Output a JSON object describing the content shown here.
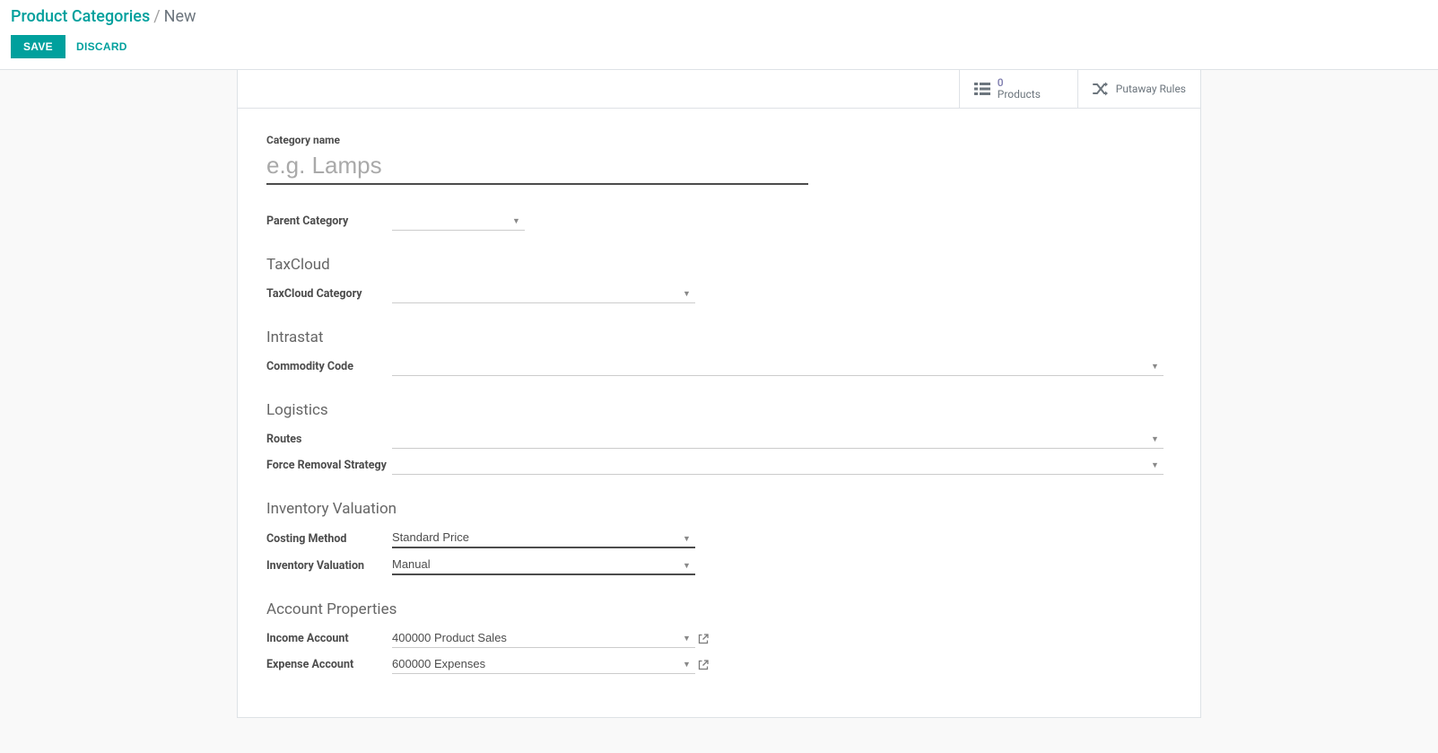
{
  "breadcrumb": {
    "parent": "Product Categories",
    "current": "New"
  },
  "buttons": {
    "save": "SAVE",
    "discard": "DISCARD"
  },
  "statButtons": {
    "products": {
      "count": "0",
      "label": "Products"
    },
    "putaway": {
      "label": "Putaway Rules"
    }
  },
  "fields": {
    "categoryName": {
      "label": "Category name",
      "placeholder": "e.g. Lamps",
      "value": ""
    },
    "parentCategory": {
      "label": "Parent Category",
      "value": ""
    }
  },
  "sections": {
    "taxcloud": {
      "title": "TaxCloud",
      "fields": {
        "category": {
          "label": "TaxCloud Category",
          "value": ""
        }
      }
    },
    "intrastat": {
      "title": "Intrastat",
      "fields": {
        "commodity": {
          "label": "Commodity Code",
          "value": ""
        }
      }
    },
    "logistics": {
      "title": "Logistics",
      "fields": {
        "routes": {
          "label": "Routes",
          "value": ""
        },
        "removal": {
          "label": "Force Removal Strategy",
          "value": ""
        }
      }
    },
    "inventoryValuation": {
      "title": "Inventory Valuation",
      "fields": {
        "costing": {
          "label": "Costing Method",
          "value": "Standard Price"
        },
        "valuation": {
          "label": "Inventory Valuation",
          "value": "Manual"
        }
      }
    },
    "accountProperties": {
      "title": "Account Properties",
      "fields": {
        "income": {
          "label": "Income Account",
          "value": "400000 Product Sales"
        },
        "expense": {
          "label": "Expense Account",
          "value": "600000 Expenses"
        }
      }
    }
  }
}
